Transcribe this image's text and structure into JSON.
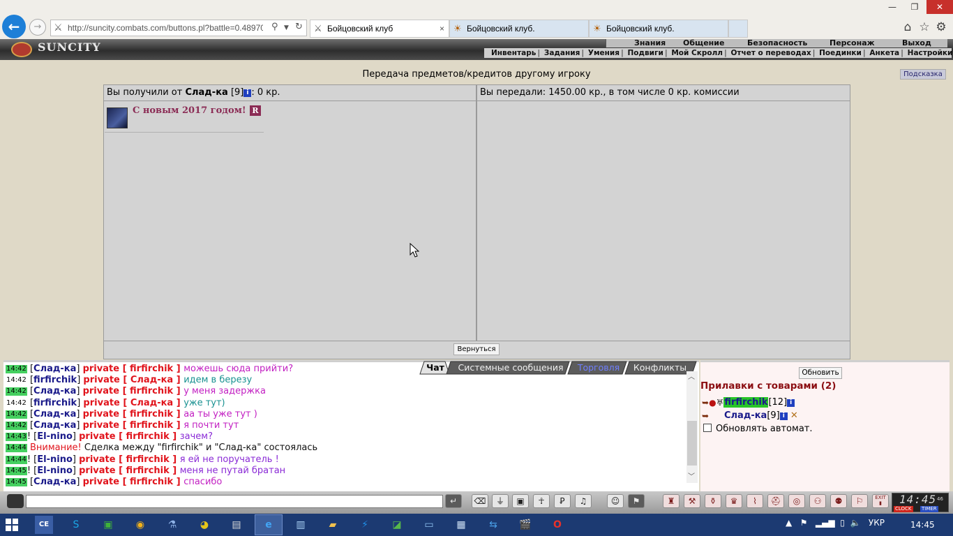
{
  "browser": {
    "url": "http://suncity.combats.com/buttons.pl?battle=0.48970",
    "tabs": [
      {
        "label": "Бойцовский клуб"
      },
      {
        "label": "Бойцовский клуб."
      },
      {
        "label": "Бойцовский клуб."
      }
    ],
    "tab_close": "×"
  },
  "game": {
    "logo": "SUNCITY",
    "top_menu": [
      "Знания",
      "Общение",
      "Безопасность",
      "Персонаж",
      "Выход"
    ],
    "sub_menu": [
      "Инвентарь",
      "Задания",
      "Умения",
      "Подвиги",
      "Мой Скролл",
      "Отчет о переводах",
      "Поединки",
      "Анкета",
      "Настройки"
    ]
  },
  "transfer": {
    "title": "Передача предметов/кредитов другому игроку",
    "hint_button": "Подсказка",
    "received_prefix": "Вы получили от",
    "received_nick": "Слад-ка",
    "received_level": "[9]",
    "received_amount": ": 0 кр.",
    "sent_text": "Вы передали: 1450.00 кр., в том числе 0 кр. комиссии",
    "gift_title": "С новым 2017 годом!",
    "gift_badge": "R",
    "back_button": "Вернуться"
  },
  "chat": {
    "tabs": [
      "Чат",
      "Системные сообщения",
      "Торговля",
      "Конфликты"
    ],
    "lines": [
      {
        "time": "14:42",
        "pre": "",
        "nick": "Слад-ка",
        "to": "firfirchik",
        "text": "можешь сюда прийти?",
        "cls": "msg-m",
        "tm": "g"
      },
      {
        "time": "14:42",
        "pre": "",
        "nick": "firfirchik",
        "to": "Слад-ка",
        "text": "идем в березу",
        "cls": "msg-t",
        "tm": "w"
      },
      {
        "time": "14:42",
        "pre": "",
        "nick": "Слад-ка",
        "to": "firfirchik",
        "text": "у меня задержка",
        "cls": "msg-m",
        "tm": "g"
      },
      {
        "time": "14:42",
        "pre": "",
        "nick": "firfirchik",
        "to": "Слад-ка",
        "text": "уже тут)",
        "cls": "msg-t",
        "tm": "w"
      },
      {
        "time": "14:42",
        "pre": "",
        "nick": "Слад-ка",
        "to": "firfirchik",
        "text": "аа ты уже тут )",
        "cls": "msg-m",
        "tm": "g"
      },
      {
        "time": "14:42",
        "pre": "",
        "nick": "Слад-ка",
        "to": "firfirchik",
        "text": "я почти тут",
        "cls": "msg-m",
        "tm": "g"
      },
      {
        "time": "14:43",
        "pre": "! ",
        "nick": "El-nino",
        "to": "firfirchik",
        "text": "зачем?",
        "cls": "msg-p",
        "tm": "g"
      },
      {
        "time": "14:44",
        "warn": "Внимание!",
        "system": " Сделка между \"firfirchik\" и \"Слад-ка\" состоялась",
        "tm": "g"
      },
      {
        "time": "14:44",
        "pre": "! ",
        "nick": "El-nino",
        "to": "firfirchik",
        "text": "я ей не поручатель !",
        "cls": "msg-p",
        "tm": "g"
      },
      {
        "time": "14:45",
        "pre": "! ",
        "nick": "El-nino",
        "to": "firfirchik",
        "text": "меня не путай братан",
        "cls": "msg-p",
        "tm": "g"
      },
      {
        "time": "14:45",
        "pre": "",
        "nick": "Слад-ка",
        "to": "firfirchik",
        "text": "спасибо",
        "cls": "msg-m",
        "tm": "g"
      }
    ],
    "private_word": "private"
  },
  "shops": {
    "refresh_button": "Обновить",
    "title": "Прилавки с товарами (2)",
    "players": [
      {
        "nick": "firfirchik",
        "level": "[12]"
      },
      {
        "nick": "Слад-ка",
        "level": "[9]"
      }
    ],
    "auto_refresh_label": "Обновлять автомат.",
    "auto_refresh_checked": false
  },
  "clock": {
    "time": "14:45",
    "seconds": "46",
    "label_clock": "CLOCK",
    "label_timer": "TIMER"
  },
  "exit_label": "EXIT",
  "taskbar": {
    "time": "14:45",
    "lang": "УКР"
  }
}
